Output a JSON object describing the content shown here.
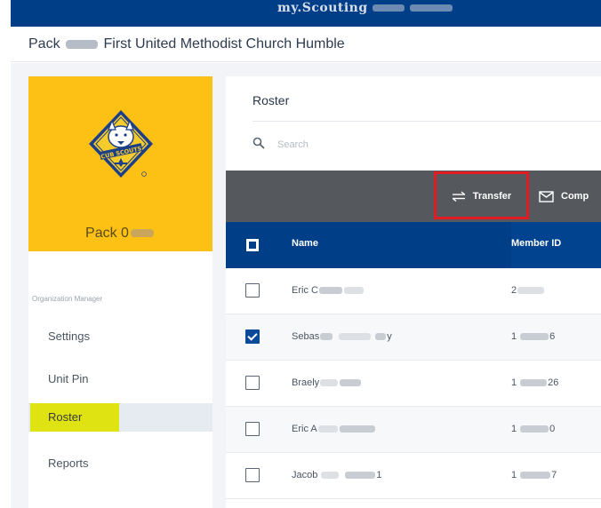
{
  "topbar": {
    "title": "my.Scouting"
  },
  "unit_header": {
    "prefix": "Pack",
    "suffix": "First United Methodist Church Humble"
  },
  "logo": {
    "alt": "cub-scouts-logo"
  },
  "sidebar": {
    "pack_name": "Pack 0",
    "section_label": "Organization Manager",
    "items": [
      {
        "label": "Settings",
        "active": false
      },
      {
        "label": "Unit Pin",
        "active": false
      },
      {
        "label": "Roster",
        "active": true
      },
      {
        "label": "Reports",
        "active": false
      }
    ]
  },
  "roster": {
    "title": "Roster",
    "search": {
      "placeholder": "Search",
      "value": ""
    },
    "toolbar": {
      "transfer_label": "Transfer",
      "compose_label": "Comp"
    },
    "columns": {
      "name": "Name",
      "member_id": "Member ID"
    },
    "rows": [
      {
        "name_start": "Eric C",
        "name_end": "",
        "id_start": "2",
        "id_end": "",
        "checked": false
      },
      {
        "name_start": "Sebas",
        "name_end": "y",
        "id_start": "1",
        "id_end": "6",
        "checked": true
      },
      {
        "name_start": "Braely",
        "name_end": "",
        "id_start": "1",
        "id_end": "26",
        "checked": false
      },
      {
        "name_start": "Eric A",
        "name_end": "",
        "id_start": "1",
        "id_end": "0",
        "checked": false
      },
      {
        "name_start": "Jacob",
        "name_end": "1",
        "id_start": "1",
        "id_end": "7",
        "checked": false
      }
    ]
  },
  "colors": {
    "navy": "#003f87",
    "gold": "#fdc116",
    "toolbar_gray": "#55595e",
    "highlight_red": "#e01b22",
    "active_yellow": "#dfe312"
  }
}
